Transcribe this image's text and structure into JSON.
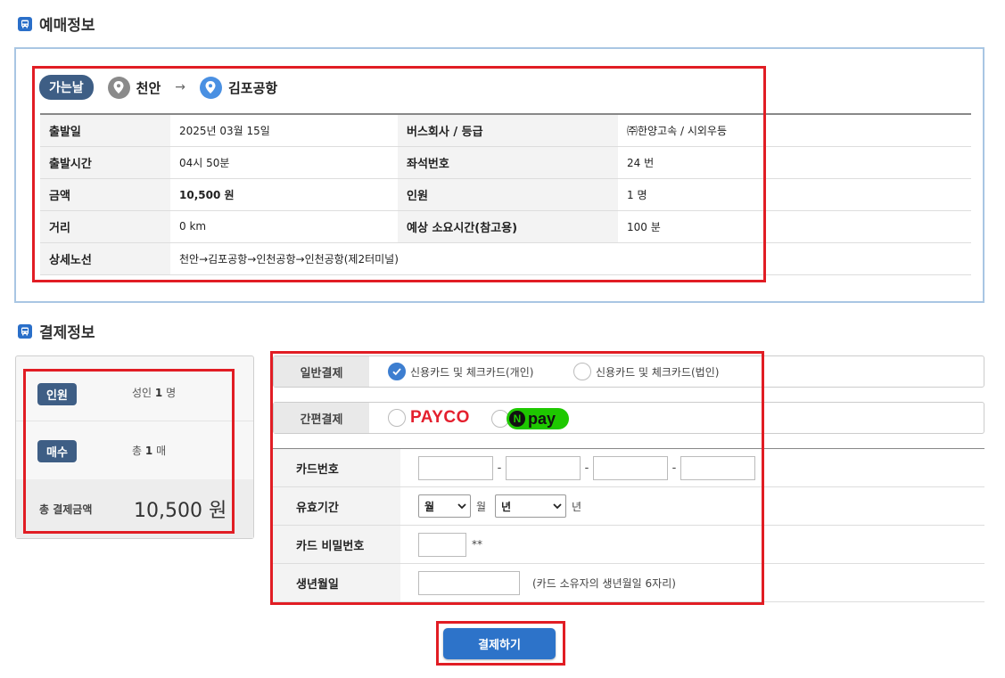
{
  "sections": {
    "reservation_title": "예매정보",
    "payment_title": "결제정보"
  },
  "route": {
    "direction": "가는날",
    "origin": "천안",
    "arrow": "→",
    "destination": "김포공항"
  },
  "ticket_info": [
    [
      {
        "label": "출발일",
        "value": "2025년 03월 15일"
      },
      {
        "label": "버스회사 / 등급",
        "value": "㈜한양고속 / 시외우등"
      }
    ],
    [
      {
        "label": "출발시간",
        "value": "04시 50분"
      },
      {
        "label": "좌석번호",
        "value": "24 번"
      }
    ],
    [
      {
        "label": "금액",
        "value": "10,500 원"
      },
      {
        "label": "인원",
        "value": "1 명"
      }
    ],
    [
      {
        "label": "거리",
        "value": "0 km"
      },
      {
        "label": "예상 소요시간(참고용)",
        "value": "100 분"
      }
    ],
    [
      {
        "label": "상세노선",
        "value": "천안→김포공항→인천공항→인천공항(제2터미널)"
      }
    ]
  ],
  "summary": {
    "people_label": "인원",
    "people_value_prefix": "성인",
    "people_count": "1",
    "people_unit": "명",
    "tickets_label": "매수",
    "tickets_prefix": "총",
    "tickets_count": "1",
    "tickets_unit": "매",
    "total_label": "총 결제금액",
    "total_value": "10,500 원"
  },
  "payment_methods": {
    "general_label": "일반결제",
    "general_options": [
      {
        "label": "신용카드 및 체크카드(개인)",
        "selected": true
      },
      {
        "label": "신용카드 및 체크카드(법인)",
        "selected": false
      }
    ],
    "simple_label": "간편결제",
    "simple_options": [
      {
        "label": "PAYCO",
        "selected": false
      },
      {
        "label": "pay",
        "badge": "N",
        "selected": false
      }
    ]
  },
  "card_form": {
    "card_number_label": "카드번호",
    "card_number_separator": "-",
    "expiry_label": "유효기간",
    "month_select": "월",
    "month_unit": "월",
    "year_select": "년",
    "year_unit": "년",
    "password_label": "카드 비밀번호",
    "password_suffix": "**",
    "birth_label": "생년월일",
    "birth_hint": "(카드 소유자의 생년월일 6자리)"
  },
  "submit_label": "결제하기",
  "colors": {
    "accent_blue": "#2d73c9",
    "pill_navy": "#3e5e85",
    "highlight_red": "#e11d24",
    "payco_red": "#e4202e",
    "npay_green": "#1ec800"
  }
}
